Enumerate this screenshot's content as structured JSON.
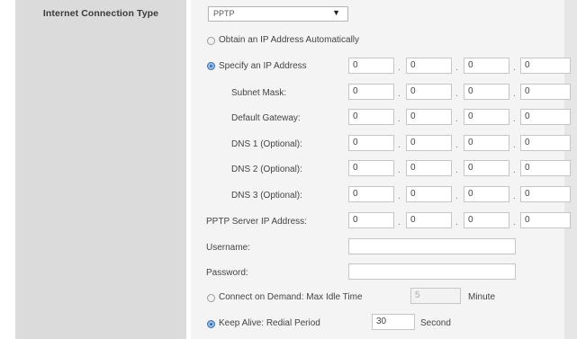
{
  "left": {
    "label": "Internet Connection Type"
  },
  "connection": {
    "selected": "PPTP",
    "arrow": "▼"
  },
  "options": {
    "auto": "Obtain an IP Address Automatically",
    "specify": "Specify an IP Address"
  },
  "rows": [
    {
      "label": "Specify an IP Address",
      "values": [
        "0",
        "0",
        "0",
        "0"
      ]
    },
    {
      "label": "Subnet Mask:",
      "values": [
        "0",
        "0",
        "0",
        "0"
      ]
    },
    {
      "label": "Default Gateway:",
      "values": [
        "0",
        "0",
        "0",
        "0"
      ]
    },
    {
      "label": "DNS 1 (Optional):",
      "values": [
        "0",
        "0",
        "0",
        "0"
      ]
    },
    {
      "label": "DNS 2 (Optional):",
      "values": [
        "0",
        "0",
        "0",
        "0"
      ]
    },
    {
      "label": "DNS 3 (Optional):",
      "values": [
        "0",
        "0",
        "0",
        "0"
      ]
    },
    {
      "label": "PPTP Server IP Address:",
      "values": [
        "0",
        "0",
        "0",
        "0"
      ]
    }
  ],
  "credentials": {
    "username_label": "Username:",
    "password_label": "Password:",
    "username_value": "",
    "password_value": ""
  },
  "connect_on_demand": {
    "label": "Connect on Demand: Max Idle Time",
    "value": "5",
    "unit": "Minute"
  },
  "keep_alive": {
    "label": "Keep Alive: Redial Period",
    "value": "30",
    "unit": "Second"
  },
  "separator": "."
}
